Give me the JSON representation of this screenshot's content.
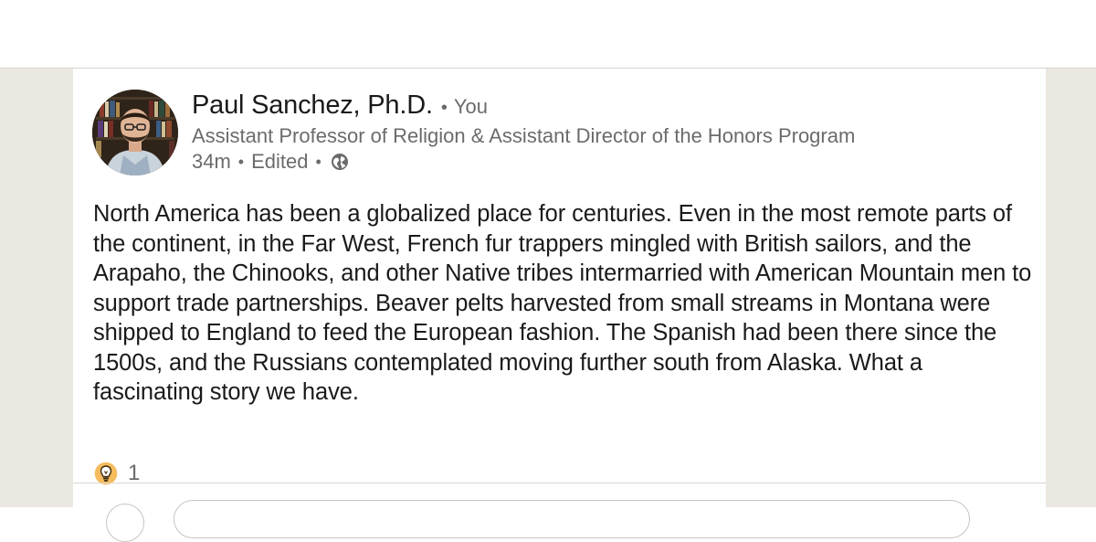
{
  "post": {
    "author_name": "Paul Sanchez, Ph.D.",
    "you_label": "You",
    "separator": "•",
    "headline": "Assistant Professor of Religion & Assistant Director of the Honors Program",
    "time": "34m",
    "edited_label": "Edited",
    "visibility_icon": "globe-icon",
    "body": "North America has been a globalized place for centuries. Even in the most remote parts of the continent, in the Far West, French fur trappers mingled with British sailors, and the Arapaho, the Chinooks, and other Native tribes intermarried with American Mountain men to support trade partnerships. Beaver pelts harvested from small streams in Montana were shipped to England to feed the European fashion. The Spanish had been there since the 1500s, and the Russians contemplated moving further south from Alaska. What a fascinating story we have.",
    "reaction_icon": "insightful-lightbulb-icon",
    "reaction_count": "1"
  },
  "colors": {
    "feed_background": "#ebe8e1",
    "card_background": "#ffffff",
    "primary_text": "#1a1a1a",
    "secondary_text": "#6b6b6b",
    "insightful_yellow": "#f5bb5c"
  }
}
